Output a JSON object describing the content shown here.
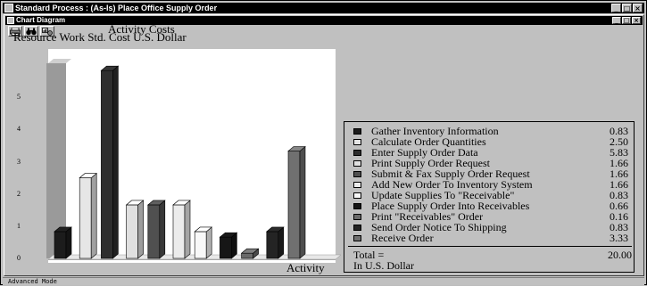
{
  "window": {
    "title": "Standard Process : (As-Is) Place Office Supply Order",
    "min": "_",
    "max": "□",
    "close": "×"
  },
  "child_window": {
    "title": "Chart Diagram",
    "min": "_",
    "max": "□",
    "close": "×"
  },
  "toolbar": {
    "buttons": [
      {
        "icon": "printer-icon"
      },
      {
        "icon": "binoculars-icon"
      },
      {
        "icon": "chart-settings-icon"
      }
    ]
  },
  "status_bar": {
    "text": "Advanced Mode"
  },
  "chart_data": {
    "type": "bar",
    "title": "Activity Costs",
    "ylabel": "Resource Work Std. Cost U.S. Dollar",
    "xlabel": "Activity",
    "yticks": [
      "0",
      "1",
      "2",
      "3",
      "4",
      "5"
    ],
    "ylim": [
      0,
      6
    ],
    "categories": [
      "Gather Inventory Information",
      "Calculate Order Quantities",
      "Enter Supply Order Data",
      "Print Supply Order Request",
      "Submit & Fax Supply Order Request",
      "Add New Order To Inventory System",
      "Update Supplies To \"Receivable\"",
      "Place Supply Order Into Receivables",
      "Print \"Receivables\" Order",
      "Send Order Notice To Shipping",
      "Receive Order"
    ],
    "values": [
      0.83,
      2.5,
      5.83,
      1.66,
      1.66,
      1.66,
      0.83,
      0.66,
      0.16,
      0.83,
      3.33
    ],
    "value_labels": [
      "0.83",
      "2.50",
      "5.83",
      "1.66",
      "1.66",
      "1.66",
      "0.83",
      "0.66",
      "0.16",
      "0.83",
      "3.33"
    ],
    "colors": [
      "#1c1c1c",
      "#e6e6e6",
      "#2e2e2e",
      "#e0e0e0",
      "#505050",
      "#ececec",
      "#f8f8f8",
      "#161616",
      "#6a6a6a",
      "#242424",
      "#707070"
    ],
    "total_label": "Total =",
    "total_value": "20.00",
    "unit_label": "In U.S. Dollar",
    "legend_position": "right",
    "grid": false
  }
}
